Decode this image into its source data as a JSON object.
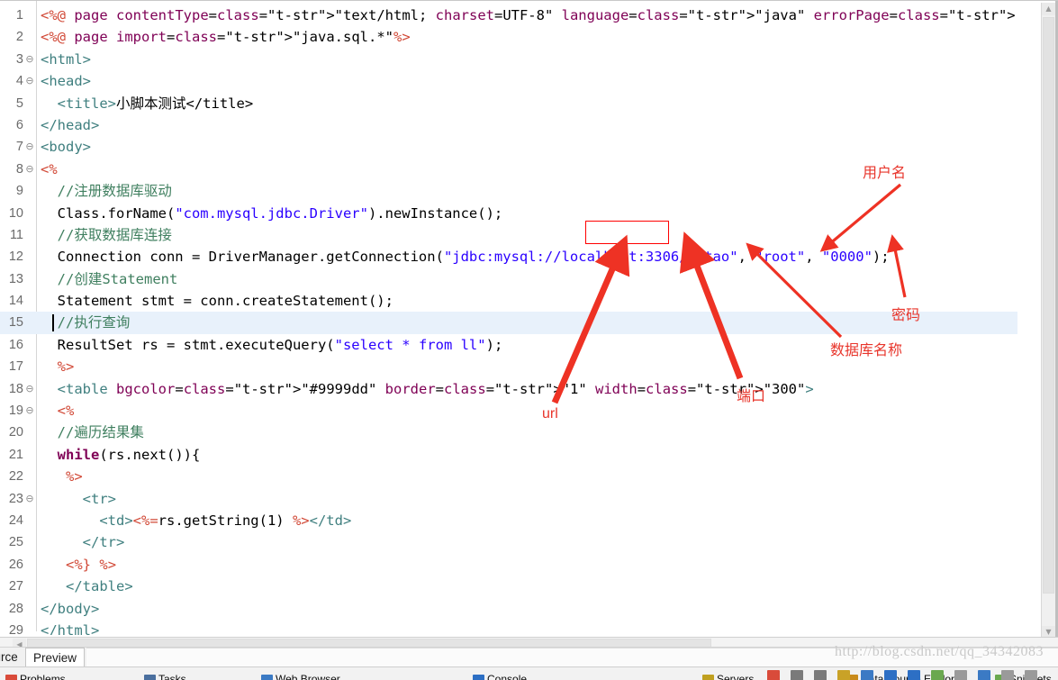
{
  "editor": {
    "file_type": "jsp",
    "current_line": 15,
    "selection_box_target": "localhost",
    "lines": [
      {
        "n": 1,
        "fold": false,
        "text": "<%@ page contentType=\"text/html; charset=UTF-8\" language=\"java\" errorPage=\"\" %>"
      },
      {
        "n": 2,
        "fold": false,
        "text": "<%@ page import=\"java.sql.*\"%>"
      },
      {
        "n": 3,
        "fold": true,
        "text": "<html>"
      },
      {
        "n": 4,
        "fold": true,
        "text": "<head>"
      },
      {
        "n": 5,
        "fold": false,
        "text": "  <title>小脚本测试</title>"
      },
      {
        "n": 6,
        "fold": false,
        "text": "</head>"
      },
      {
        "n": 7,
        "fold": true,
        "text": "<body>"
      },
      {
        "n": 8,
        "fold": true,
        "text": "<%"
      },
      {
        "n": 9,
        "fold": false,
        "text": "  //注册数据库驱动"
      },
      {
        "n": 10,
        "fold": false,
        "text": "  Class.forName(\"com.mysql.jdbc.Driver\").newInstance();"
      },
      {
        "n": 11,
        "fold": false,
        "text": "  //获取数据库连接"
      },
      {
        "n": 12,
        "fold": false,
        "text": "  Connection conn = DriverManager.getConnection(\"jdbc:mysql://localhost:3306/litao\", \"root\", \"0000\");"
      },
      {
        "n": 13,
        "fold": false,
        "text": "  //创建Statement"
      },
      {
        "n": 14,
        "fold": false,
        "text": "  Statement stmt = conn.createStatement();"
      },
      {
        "n": 15,
        "fold": false,
        "text": "  //执行查询"
      },
      {
        "n": 16,
        "fold": false,
        "text": "  ResultSet rs = stmt.executeQuery(\"select * from ll\");"
      },
      {
        "n": 17,
        "fold": false,
        "text": "  %>"
      },
      {
        "n": 18,
        "fold": true,
        "text": "  <table bgcolor=\"#9999dd\" border=\"1\" width=\"300\">"
      },
      {
        "n": 19,
        "fold": true,
        "text": "  <%"
      },
      {
        "n": 20,
        "fold": false,
        "text": "  //遍历结果集"
      },
      {
        "n": 21,
        "fold": false,
        "text": "  while(rs.next()){"
      },
      {
        "n": 22,
        "fold": false,
        "text": "   %>"
      },
      {
        "n": 23,
        "fold": true,
        "text": "     <tr>"
      },
      {
        "n": 24,
        "fold": false,
        "text": "       <td><%=rs.getString(1) %></td>"
      },
      {
        "n": 25,
        "fold": false,
        "text": "     </tr>"
      },
      {
        "n": 26,
        "fold": false,
        "text": "   <%} %>"
      },
      {
        "n": 27,
        "fold": false,
        "text": "   </table>"
      },
      {
        "n": 28,
        "fold": false,
        "text": "</body>"
      },
      {
        "n": 29,
        "fold": false,
        "text": "</html>"
      }
    ]
  },
  "annotations": {
    "color": "#e8352b",
    "items": [
      {
        "id": "url",
        "label": "url",
        "latin": true
      },
      {
        "id": "port",
        "label": "端口",
        "latin": false
      },
      {
        "id": "dbname",
        "label": "数据库名称",
        "latin": false
      },
      {
        "id": "username",
        "label": "用户名",
        "latin": false
      },
      {
        "id": "password",
        "label": "密码",
        "latin": false
      }
    ]
  },
  "watermark": {
    "text": "http://blog.csdn.net/qq_34342083"
  },
  "bottom_tabs": {
    "source_label": "ource",
    "preview_label": "Preview",
    "view_tabs": [
      {
        "label": "Problems",
        "color": "#d94b3a"
      },
      {
        "label": "Tasks",
        "color": "#4a6f9e"
      },
      {
        "label": "Web Browser",
        "color": "#3b7ac4"
      },
      {
        "label": "Console",
        "color": "#2d6fc4"
      },
      {
        "label": "Servers",
        "color": "#c0a020"
      },
      {
        "label": "Data Source Explorer",
        "color": "#c98b1b"
      },
      {
        "label": "Snippets",
        "color": "#6aa84f"
      }
    ]
  },
  "scrollbars": {
    "vertical_arrow_up": "▲",
    "vertical_arrow_down": "▼",
    "horizontal_arrow_left": "◀"
  }
}
